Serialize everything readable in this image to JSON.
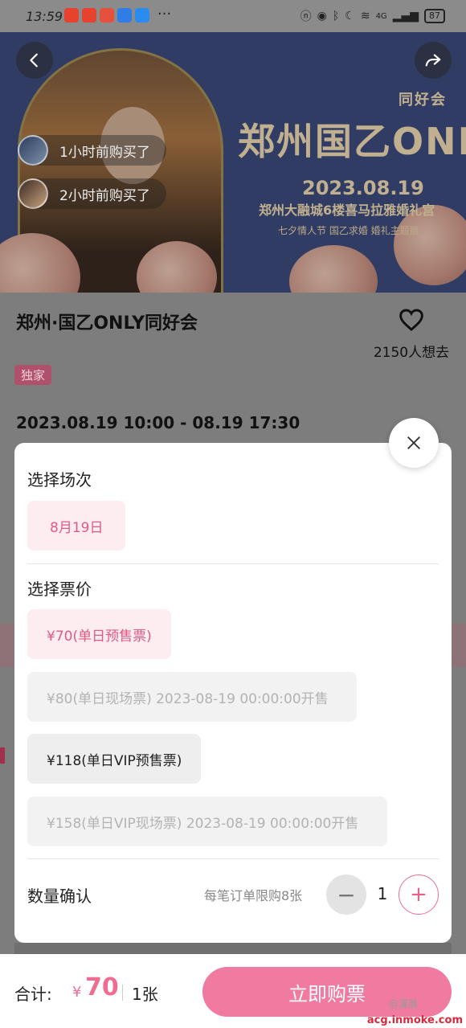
{
  "status_bar": {
    "time": "13:59",
    "dots": "···",
    "network_label": "4G",
    "battery": "87"
  },
  "hero": {
    "title_main": "郑州国乙ONLY",
    "title_sub": "同好会",
    "date": "2023.08.19",
    "venue": "郑州大融城6楼喜马拉雅婚礼宫",
    "theme": "七夕情人节 国乙求婚 婚礼主题展",
    "buyers": [
      {
        "text": "1小时前购买了"
      },
      {
        "text": "2小时前购买了"
      }
    ]
  },
  "event": {
    "title": "郑州·国乙ONLY同好会",
    "want_count": "2150人想去",
    "tag": "独家",
    "datetime": "2023.08.19 10:00 - 08.19 17:30"
  },
  "sheet": {
    "session_title": "选择场次",
    "sessions": [
      {
        "label": "8月19日",
        "state": "selected"
      }
    ],
    "price_title": "选择票价",
    "tickets": [
      {
        "label": "¥70(单日预售票)",
        "state": "selected"
      },
      {
        "label": "¥80(单日现场票) 2023-08-19 00:00:00开售",
        "state": "disabled"
      },
      {
        "label": "¥118(单日VIP预售票)",
        "state": "normal"
      },
      {
        "label": "¥158(单日VIP现场票) 2023-08-19 00:00:00开售",
        "state": "disabled"
      }
    ],
    "qty_title": "数量确认",
    "limit_text": "每笔订单限购8张",
    "quantity": "1",
    "minus": "−",
    "plus": "+"
  },
  "bottom": {
    "total_label": "合计:",
    "currency": "¥",
    "price": "70",
    "count": "1张",
    "buy_label": "立即购票"
  },
  "watermark": "acg.inmoke.com",
  "watermark_small": "@漫展",
  "colors": {
    "accent": "#ef6d91",
    "selected_bg": "#fdecf0",
    "buy_button": "#f07aa0",
    "hero_bg": "#3e4e80"
  }
}
